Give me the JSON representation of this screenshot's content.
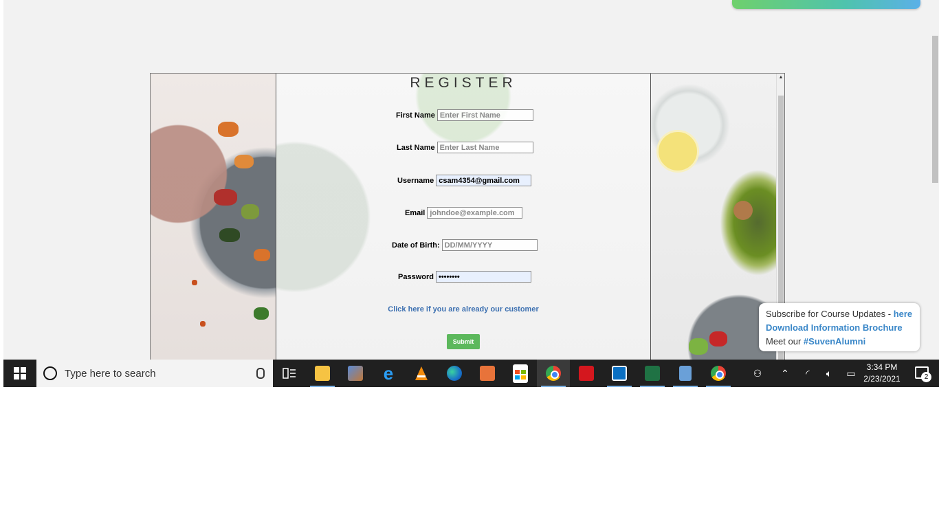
{
  "form": {
    "title": "REGISTER",
    "first_name": {
      "label": "First Name",
      "placeholder": "Enter First Name",
      "value": ""
    },
    "last_name": {
      "label": "Last Name",
      "placeholder": "Enter Last Name",
      "value": ""
    },
    "username": {
      "label": "Username",
      "value": "csam4354@gmail.com"
    },
    "email": {
      "label": "Email",
      "placeholder": "johndoe@example.com",
      "value": ""
    },
    "dob": {
      "label": "Date of Birth:",
      "placeholder": "DD/MM/YYYY",
      "value": ""
    },
    "password": {
      "label": "Password",
      "value": "••••••••"
    },
    "login_link": "Click here",
    "login_text": " if you are already our customer",
    "submit": "Submit"
  },
  "promo": {
    "line1_text": "Subscribe for Course Updates - ",
    "line1_link": "here",
    "line2_link": "Download Information Brochure",
    "line3_text": "Meet our ",
    "line3_link": "#SuvenAlumni"
  },
  "taskbar": {
    "search_placeholder": "Type here to search",
    "time": "3:34 PM",
    "date": "2/23/2021",
    "notification_count": "2",
    "apps": [
      "task-view",
      "file-explorer",
      "paint-app",
      "internet-explorer",
      "vlc",
      "edge",
      "office",
      "store",
      "chrome",
      "acrobat",
      "app-blue",
      "excel",
      "calculator",
      "chrome-2"
    ]
  },
  "colors": {
    "accent": "#5cb85c",
    "link": "#3a87c8",
    "taskbar": "#202020"
  }
}
